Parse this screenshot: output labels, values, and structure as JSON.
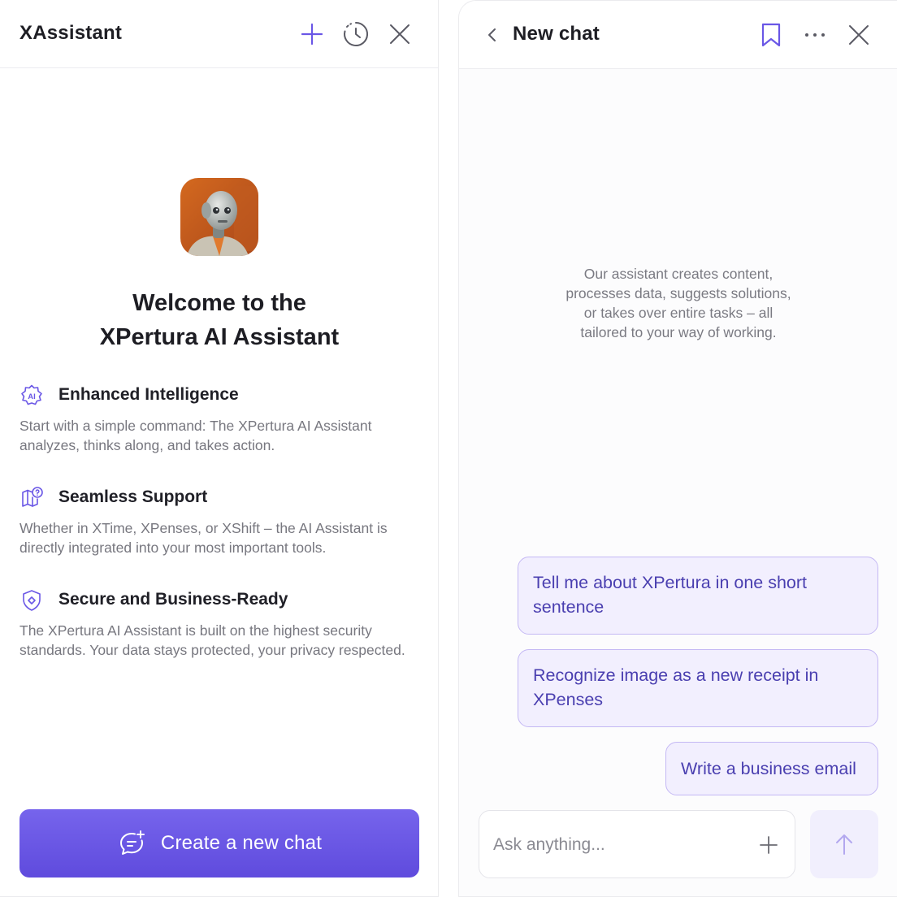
{
  "colors": {
    "accent": "#6a57e6",
    "accent_light": "#f2effe",
    "suggestion_border": "#c4b8f4",
    "muted_text": "#77777f"
  },
  "left_panel": {
    "title": "XAssistant",
    "header_icons": [
      "plus-icon",
      "history-clock-icon",
      "close-icon"
    ],
    "welcome_line1": "Welcome to the",
    "welcome_line2": "XPertura AI Assistant",
    "features": [
      {
        "icon": "ai-badge-icon",
        "heading": "Enhanced Intelligence",
        "text": "Start with a simple command: The XPertura AI Assistant analyzes, thinks along, and takes action."
      },
      {
        "icon": "support-map-question-icon",
        "heading": "Seamless Support",
        "text": "Whether in XTime, XPenses, or XShift – the AI Assistant is directly integrated into your most important tools."
      },
      {
        "icon": "shield-icon",
        "heading": "Secure and Business-Ready",
        "text": "The XPertura AI Assistant is built on the highest security standards. Your data stays protected, your privacy respected."
      }
    ],
    "new_chat_button": {
      "label": "Create a new chat",
      "icon": "chat-plus-icon"
    }
  },
  "right_panel": {
    "title": "New chat",
    "header_icons": [
      "back-chevron-icon",
      "bookmark-icon",
      "more-dots-icon",
      "close-icon"
    ],
    "intro_line1": "Our assistant creates content,",
    "intro_line2": "processes data, suggests solutions,",
    "intro_line3": "or takes over entire tasks – all",
    "intro_line4": "tailored to your way of working.",
    "suggestions": [
      {
        "line1": "Tell me about XPertura in one short",
        "line2": "sentence"
      },
      {
        "line1": "Recognize image as a new receipt in",
        "line2": "XPenses"
      },
      {
        "line1": "Write a business email",
        "line2": ""
      }
    ],
    "input": {
      "placeholder": "Ask anything...",
      "value": ""
    },
    "send_icon": "arrow-up-icon"
  }
}
